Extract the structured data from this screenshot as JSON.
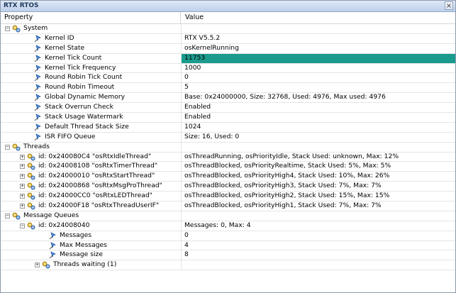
{
  "window": {
    "title": "RTX RTOS",
    "close_label": "×"
  },
  "columns": {
    "property": "Property",
    "value": "Value"
  },
  "rows": [
    {
      "name": "System",
      "value": "",
      "level": 0,
      "kind": "group",
      "expander": "−"
    },
    {
      "name": "Kernel ID",
      "value": "RTX V5.5.2",
      "level": 1,
      "kind": "prop"
    },
    {
      "name": "Kernel State",
      "value": "osKernelRunning",
      "level": 1,
      "kind": "prop"
    },
    {
      "name": "Kernel Tick Count",
      "value": "11753",
      "level": 1,
      "kind": "prop",
      "highlight": true
    },
    {
      "name": "Kernel Tick Frequency",
      "value": "1000",
      "level": 1,
      "kind": "prop"
    },
    {
      "name": "Round Robin Tick Count",
      "value": "0",
      "level": 1,
      "kind": "prop"
    },
    {
      "name": "Round Robin Timeout",
      "value": "5",
      "level": 1,
      "kind": "prop"
    },
    {
      "name": "Global Dynamic Memory",
      "value": "Base: 0x24000000, Size: 32768, Used: 4976, Max used: 4976",
      "level": 1,
      "kind": "prop"
    },
    {
      "name": "Stack Overrun Check",
      "value": "Enabled",
      "level": 1,
      "kind": "prop"
    },
    {
      "name": "Stack Usage Watermark",
      "value": "Enabled",
      "level": 1,
      "kind": "prop"
    },
    {
      "name": "Default Thread Stack Size",
      "value": "1024",
      "level": 1,
      "kind": "prop"
    },
    {
      "name": "ISR FIFO Queue",
      "value": "Size: 16, Used: 0",
      "level": 1,
      "kind": "prop"
    },
    {
      "name": "Threads",
      "value": "",
      "level": 0,
      "kind": "group",
      "expander": "−"
    },
    {
      "name": "id: 0x240080C4 \"osRtxIdleThread\"",
      "value": "osThreadRunning, osPriorityIdle, Stack Used: unknown, Max: 12%",
      "level": 1,
      "kind": "group",
      "expander": "+"
    },
    {
      "name": "id: 0x24008108 \"osRtxTimerThread\"",
      "value": "osThreadBlocked, osPriorityRealtime, Stack Used: 5%, Max: 5%",
      "level": 1,
      "kind": "group",
      "expander": "+"
    },
    {
      "name": "id: 0x24000010 \"osRtxStartThread\"",
      "value": "osThreadBlocked, osPriorityHigh4, Stack Used: 10%, Max: 26%",
      "level": 1,
      "kind": "group",
      "expander": "+"
    },
    {
      "name": "id: 0x24000868 \"osRtxMsgProThread\"",
      "value": "osThreadBlocked, osPriorityHigh3, Stack Used: 7%, Max: 7%",
      "level": 1,
      "kind": "group",
      "expander": "+"
    },
    {
      "name": "id: 0x24000CC0 \"osRtxLEDThread\"",
      "value": "osThreadBlocked, osPriorityHigh2, Stack Used: 15%, Max: 15%",
      "level": 1,
      "kind": "group",
      "expander": "+"
    },
    {
      "name": "id: 0x24000F18 \"osRtxThreadUserIF\"",
      "value": "osThreadBlocked, osPriorityHigh1, Stack Used: 7%, Max: 7%",
      "level": 1,
      "kind": "group",
      "expander": "+"
    },
    {
      "name": "Message Queues",
      "value": "",
      "level": 0,
      "kind": "group",
      "expander": "−"
    },
    {
      "name": "id: 0x24008040",
      "value": "Messages: 0, Max: 4",
      "level": 1,
      "kind": "group",
      "expander": "−"
    },
    {
      "name": "Messages",
      "value": "0",
      "level": 2,
      "kind": "prop"
    },
    {
      "name": "Max Messages",
      "value": "4",
      "level": 2,
      "kind": "prop"
    },
    {
      "name": "Message size",
      "value": "8",
      "level": 2,
      "kind": "prop"
    },
    {
      "name": "Threads waiting (1)",
      "value": "",
      "level": 2,
      "kind": "group",
      "expander": "+"
    }
  ],
  "colors": {
    "highlight": "#1a9b8d",
    "grid_line": "#e5e5e5",
    "title_text": "#1e395b"
  },
  "icons": {
    "group": "gear-node-icon",
    "property": "pin-icon",
    "close": "close-icon"
  }
}
